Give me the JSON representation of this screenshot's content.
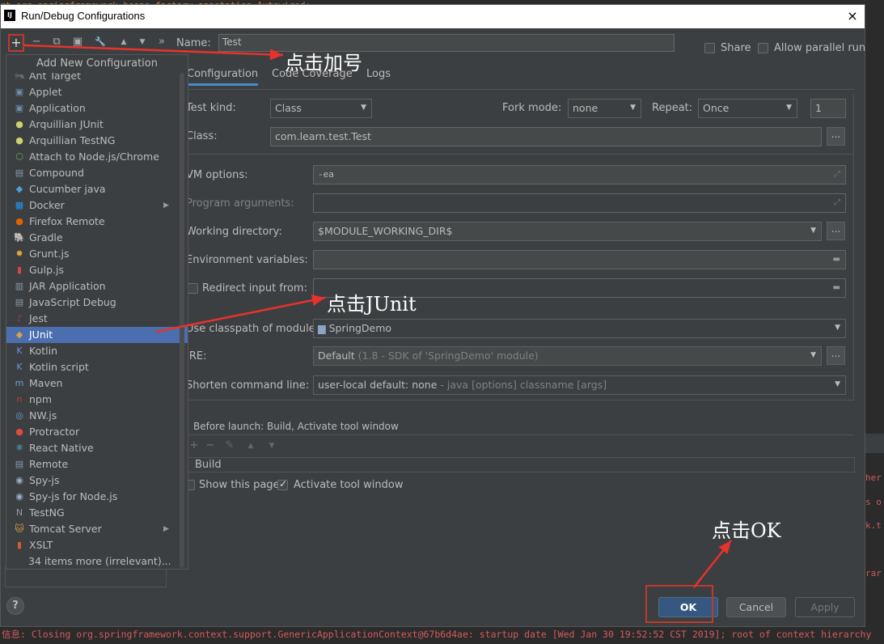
{
  "background": {
    "top_code": "rt org.springframework.beans.factory.annotation.Autowired;",
    "right_gutter": [
      "her",
      "s o",
      "k.t",
      "rar"
    ],
    "bottom_log": "信息: Closing org.springframework.context.support.GenericApplicationContext@67b6d4ae: startup date [Wed Jan 30 19:52:52 CST 2019]; root of context hierarchy"
  },
  "dialog": {
    "title": "Run/Debug Configurations",
    "app_icon": "IJ",
    "close_icon": "×"
  },
  "toolbar": {
    "add": "+",
    "remove": "−",
    "copy": "⧉",
    "save": "▣",
    "wrench": "🔧",
    "up": "▲",
    "down": "▼",
    "more": "»",
    "name_label": "Name:",
    "name_value": "Test",
    "share_label": "Share",
    "allow_parallel_label": "Allow parallel run"
  },
  "tabs": [
    "Configuration",
    "Code Coverage",
    "Logs"
  ],
  "form": {
    "test_kind_label": "Test kind:",
    "test_kind_value": "Class",
    "fork_mode_label": "Fork mode:",
    "fork_mode_value": "none",
    "repeat_label": "Repeat:",
    "repeat_value": "Once",
    "repeat_count": "1",
    "class_label": "Class:",
    "class_value": "com.learn.test.Test",
    "vm_options_label": "VM options:",
    "vm_options_value": "-ea",
    "program_args_label": "Program arguments:",
    "working_dir_label": "Working directory:",
    "working_dir_value": "$MODULE_WORKING_DIR$",
    "env_vars_label": "Environment variables:",
    "redirect_label": "Redirect input from:",
    "classpath_label": "Use classpath of module:",
    "classpath_value": "SpringDemo",
    "jre_label": "JRE:",
    "jre_value_main": "Default",
    "jre_value_detail": "(1.8 - SDK of 'SpringDemo' module)",
    "shorten_label": "Shorten command line:",
    "shorten_value_main": "user-local default: none",
    "shorten_value_detail": "- java [options] classname [args]",
    "dots": "..."
  },
  "before_launch": {
    "title": "Before launch: Build, Activate tool window",
    "build_item": "Build",
    "show_page_label": "Show this page",
    "activate_label": "Activate tool window"
  },
  "popup": {
    "header": "Add New Configuration",
    "items": [
      {
        "label": "Ant Target",
        "icon": "ant-icon",
        "color": "#7a7a7a",
        "glyph": "🐜"
      },
      {
        "label": "Applet",
        "icon": "applet-icon",
        "color": "#6a8fb0",
        "glyph": "▣"
      },
      {
        "label": "Application",
        "icon": "application-icon",
        "color": "#6a8fb0",
        "glyph": "▣"
      },
      {
        "label": "Arquillian JUnit",
        "icon": "arquillian-icon",
        "color": "#c9d36e",
        "glyph": "●"
      },
      {
        "label": "Arquillian TestNG",
        "icon": "arquillian-testng-icon",
        "color": "#c9d36e",
        "glyph": "●"
      },
      {
        "label": "Attach to Node.js/Chrome",
        "icon": "nodejs-icon",
        "color": "#6fa35c",
        "glyph": "⬡"
      },
      {
        "label": "Compound",
        "icon": "compound-icon",
        "color": "#8a9aa8",
        "glyph": "▤"
      },
      {
        "label": "Cucumber java",
        "icon": "cucumber-icon",
        "color": "#4fa0d9",
        "glyph": "◆"
      },
      {
        "label": "Docker",
        "icon": "docker-icon",
        "color": "#2496ed",
        "glyph": "▦",
        "submenu": true
      },
      {
        "label": "Firefox Remote",
        "icon": "firefox-icon",
        "color": "#e66000",
        "glyph": "●"
      },
      {
        "label": "Gradle",
        "icon": "gradle-icon",
        "color": "#8a9a8a",
        "glyph": "🐘"
      },
      {
        "label": "Grunt.js",
        "icon": "grunt-icon",
        "color": "#e4a73c",
        "glyph": "✹"
      },
      {
        "label": "Gulp.js",
        "icon": "gulp-icon",
        "color": "#cf4647",
        "glyph": "▮"
      },
      {
        "label": "JAR Application",
        "icon": "jar-icon",
        "color": "#8a9aa8",
        "glyph": "▥"
      },
      {
        "label": "JavaScript Debug",
        "icon": "js-debug-icon",
        "color": "#8a9aa8",
        "glyph": "▤"
      },
      {
        "label": "Jest",
        "icon": "jest-icon",
        "color": "#99425b",
        "glyph": "♪"
      },
      {
        "label": "JUnit",
        "icon": "junit-icon",
        "color": "#d8a04a",
        "glyph": "◆"
      },
      {
        "label": "Kotlin",
        "icon": "kotlin-icon",
        "color": "#6f8ee0",
        "glyph": "K"
      },
      {
        "label": "Kotlin script",
        "icon": "kotlin-script-icon",
        "color": "#6f8ee0",
        "glyph": "K"
      },
      {
        "label": "Maven",
        "icon": "maven-icon",
        "color": "#6fa0d8",
        "glyph": "m"
      },
      {
        "label": "npm",
        "icon": "npm-icon",
        "color": "#cb3837",
        "glyph": "n"
      },
      {
        "label": "NW.js",
        "icon": "nwjs-icon",
        "color": "#6aa0d0",
        "glyph": "◎"
      },
      {
        "label": "Protractor",
        "icon": "protractor-icon",
        "color": "#e14b3b",
        "glyph": "●"
      },
      {
        "label": "React Native",
        "icon": "react-icon",
        "color": "#61dafb",
        "glyph": "⚛"
      },
      {
        "label": "Remote",
        "icon": "remote-icon",
        "color": "#8a9aa8",
        "glyph": "▤"
      },
      {
        "label": "Spy-js",
        "icon": "spyjs-icon",
        "color": "#9ab0c8",
        "glyph": "◉"
      },
      {
        "label": "Spy-js for Node.js",
        "icon": "spyjs-node-icon",
        "color": "#9ab0c8",
        "glyph": "◉"
      },
      {
        "label": "TestNG",
        "icon": "testng-icon",
        "color": "#9a9a9a",
        "glyph": "N"
      },
      {
        "label": "Tomcat Server",
        "icon": "tomcat-icon",
        "color": "#d8a04a",
        "glyph": "🐱",
        "submenu": true
      },
      {
        "label": "XSLT",
        "icon": "xslt-icon",
        "color": "#d35b2f",
        "glyph": "▮"
      },
      {
        "label": "34 items more (irrelevant)...",
        "icon": "",
        "color": "",
        "glyph": ""
      }
    ],
    "selected": "JUnit",
    "submenu_arrow": "▶"
  },
  "buttons": {
    "ok": "OK",
    "cancel": "Cancel",
    "apply": "Apply",
    "help": "?"
  },
  "annotations": {
    "click_plus": "点击加号",
    "click_junit": "点击JUnit",
    "click_ok": "点击OK",
    "arrow_color": "#e8322d"
  }
}
